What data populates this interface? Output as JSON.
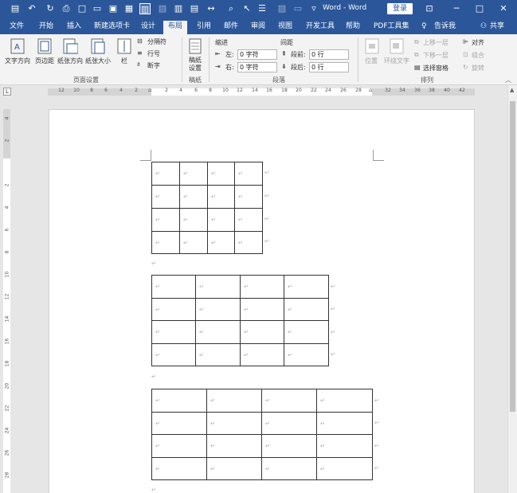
{
  "title_bar": {
    "doc_title": "Word - Word",
    "login_label": "登录",
    "quick_access_icons": [
      "save-icon",
      "undo-icon",
      "redo-icon",
      "print-preview-icon",
      "new-icon",
      "open-icon",
      "paste-icon",
      "format-painter-icon",
      "read-mode-icon"
    ]
  },
  "menu": {
    "tabs": [
      "文件",
      "开始",
      "插入",
      "新建选项卡",
      "设计",
      "布局",
      "引用",
      "邮件",
      "审阅",
      "视图",
      "开发工具",
      "帮助",
      "PDF工具集"
    ],
    "active_tab": "布局",
    "tell_me": "告诉我",
    "share": "共享"
  },
  "ribbon": {
    "page_setup": {
      "text_direction": "文字方向",
      "margins": "页边距",
      "orientation": "纸张方向",
      "size": "纸张大小",
      "columns": "栏",
      "breaks": "分隔符",
      "line_numbers": "行号",
      "hyphenation": "断字",
      "group_label": "页面设置"
    },
    "manuscript": {
      "button": "稿纸设置",
      "group_label": "稿纸"
    },
    "paragraph": {
      "indent_header": "缩进",
      "spacing_header": "间距",
      "left_label": "左:",
      "left_value": "0 字符",
      "right_label": "右:",
      "right_value": "0 字符",
      "before_label": "段前:",
      "before_value": "0 行",
      "after_label": "段后:",
      "after_value": "0 行",
      "group_label": "段落"
    },
    "arrange": {
      "position": "位置",
      "wrap_text": "环绕文字",
      "bring_forward": "上移一层",
      "send_backward": "下移一层",
      "selection_pane": "选择窗格",
      "align": "对齐",
      "group": "组合",
      "rotate": "旋转",
      "group_label": "排列"
    }
  },
  "ruler": {
    "h_ticks": [
      "12",
      "10",
      "8",
      "6",
      "4",
      "2",
      "2",
      "4",
      "6",
      "8",
      "10",
      "12",
      "14",
      "16",
      "18",
      "20",
      "22",
      "24",
      "26",
      "28",
      "32",
      "34",
      "36",
      "38",
      "40",
      "42"
    ],
    "v_ticks": [
      "4",
      "2",
      "2",
      "4",
      "6",
      "8",
      "10",
      "12",
      "14",
      "16",
      "18",
      "20",
      "22",
      "24",
      "26",
      "28"
    ]
  },
  "document": {
    "cell_mark": "↵",
    "tables": [
      {
        "rows": 4,
        "cols": 4
      },
      {
        "rows": 4,
        "cols": 4
      },
      {
        "rows": 4,
        "cols": 4
      }
    ]
  }
}
